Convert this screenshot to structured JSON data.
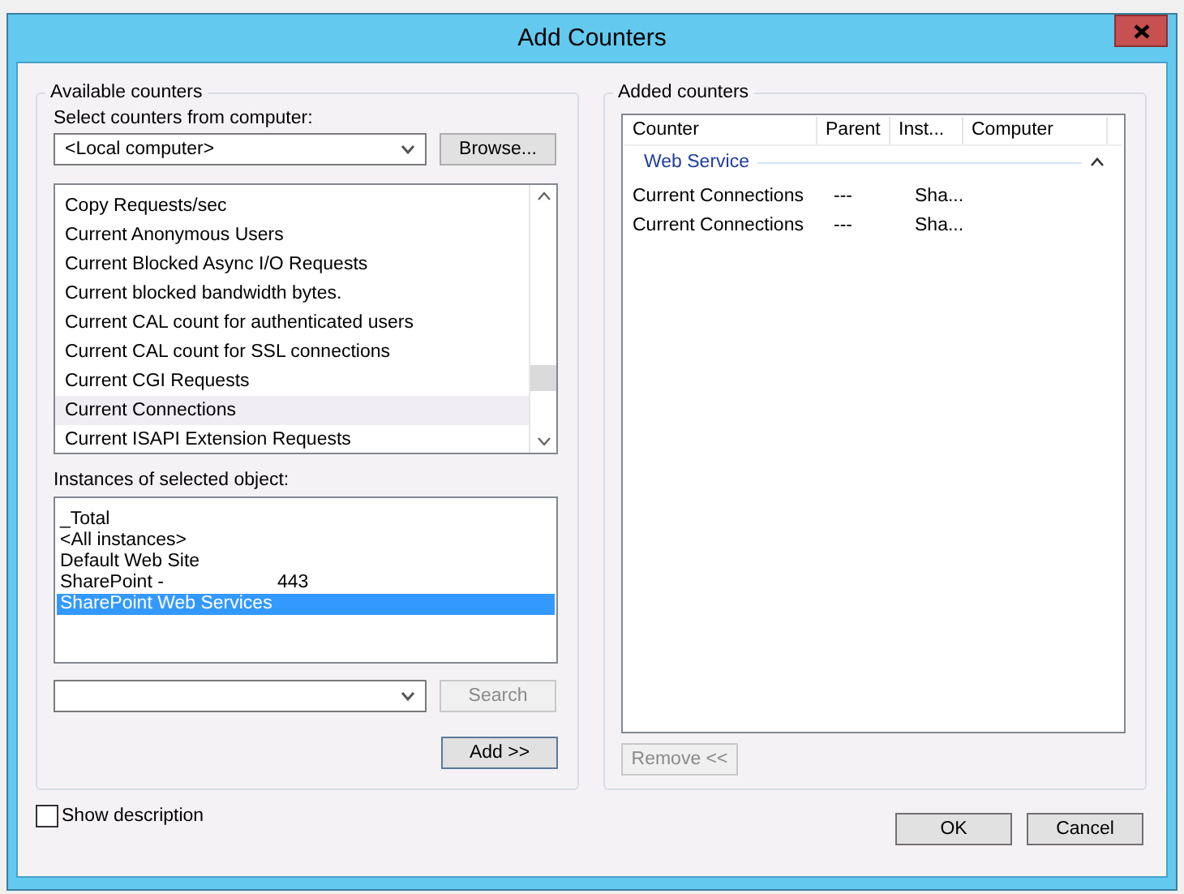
{
  "window": {
    "title": "Add Counters"
  },
  "available": {
    "legend": "Available counters",
    "computer_label": "Select counters from computer:",
    "computer_value": "<Local computer>",
    "browse_button": "Browse...",
    "counters": [
      {
        "label": "Copy Requests/sec",
        "selected": false
      },
      {
        "label": "Current Anonymous Users",
        "selected": false
      },
      {
        "label": "Current Blocked Async I/O Requests",
        "selected": false
      },
      {
        "label": "Current blocked bandwidth bytes.",
        "selected": false
      },
      {
        "label": "Current CAL count for authenticated users",
        "selected": false
      },
      {
        "label": "Current CAL count for SSL connections",
        "selected": false
      },
      {
        "label": "Current CGI Requests",
        "selected": false
      },
      {
        "label": "Current Connections",
        "selected": true
      },
      {
        "label": "Current ISAPI Extension Requests",
        "selected": false
      }
    ],
    "instances_label": "Instances of selected object:",
    "instances": [
      {
        "label": "_Total",
        "selected": false
      },
      {
        "label": "<All instances>",
        "selected": false
      },
      {
        "label": "Default Web Site",
        "selected": false
      },
      {
        "label": "SharePoint -",
        "selected": false,
        "suffix": "443"
      },
      {
        "label": "SharePoint Web Services",
        "selected": true
      }
    ],
    "search_button": {
      "label": "Search",
      "disabled": true
    },
    "add_button": "Add >>"
  },
  "added": {
    "legend": "Added counters",
    "columns": [
      "Counter",
      "Parent",
      "Inst...",
      "Computer"
    ],
    "group": {
      "label": "Web Service",
      "expanded": true
    },
    "rows": [
      [
        "Current Connections",
        "---",
        "Sha..."
      ],
      [
        "Current Connections",
        "---",
        "Sha..."
      ]
    ],
    "remove_button": {
      "label": "Remove <<",
      "disabled": true
    }
  },
  "show_description": {
    "label": "Show description",
    "checked": false
  },
  "buttons": [
    "OK",
    "Cancel"
  ]
}
